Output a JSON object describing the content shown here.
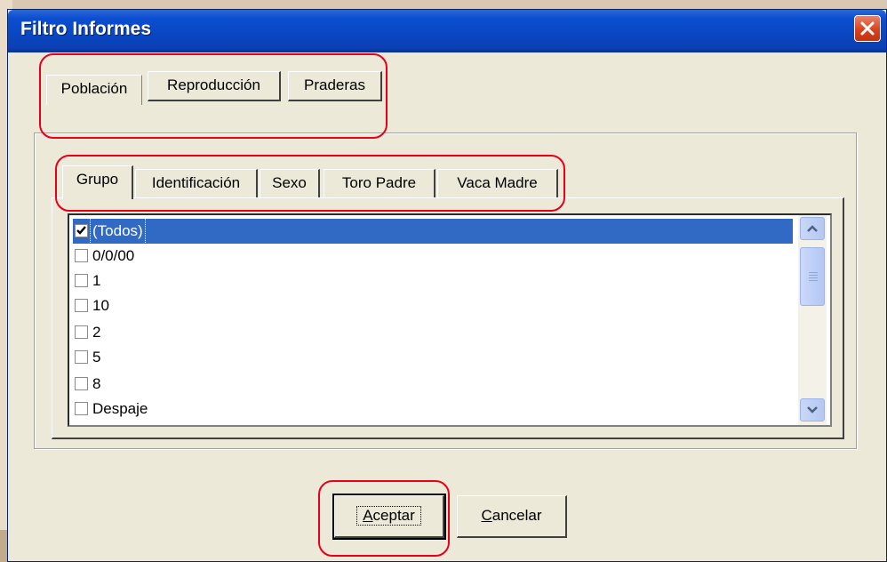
{
  "window": {
    "title": "Filtro Informes"
  },
  "outer_tabs": [
    {
      "label": "Población",
      "active": true
    },
    {
      "label": "Reproducción",
      "active": false
    },
    {
      "label": "Praderas",
      "active": false
    }
  ],
  "inner_tabs": [
    {
      "label": "Grupo",
      "active": true
    },
    {
      "label": "Identificación",
      "active": false
    },
    {
      "label": "Sexo",
      "active": false
    },
    {
      "label": "Toro Padre",
      "active": false
    },
    {
      "label": "Vaca Madre",
      "active": false
    }
  ],
  "list": {
    "items": [
      {
        "label": "(Todos)",
        "checked": true,
        "selected": true
      },
      {
        "label": "0/0/00",
        "checked": false
      },
      {
        "label": "1",
        "checked": false
      },
      {
        "label": "10",
        "checked": false
      },
      {
        "label": "2",
        "checked": false
      },
      {
        "label": "5",
        "checked": false
      },
      {
        "label": "8",
        "checked": false
      },
      {
        "label": "Despaje",
        "checked": false
      }
    ]
  },
  "buttons": {
    "ok": {
      "mnemonic": "A",
      "rest": "ceptar"
    },
    "cancel": {
      "mnemonic": "C",
      "rest": "ancelar"
    }
  },
  "colors": {
    "highlight": "#e8001a",
    "selection": "#316ac5",
    "titlebar": "#0a46c2"
  }
}
